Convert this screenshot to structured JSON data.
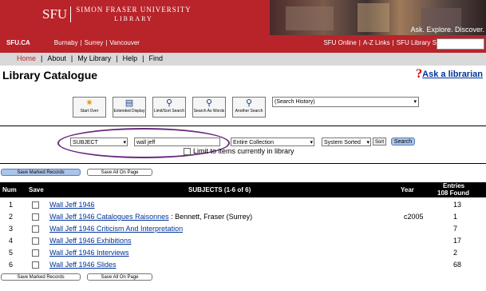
{
  "header": {
    "logo": "SFU",
    "university_name": "SIMON FRASER UNIVERSITY",
    "library_name": "LIBRARY",
    "tagline": "Ask. Explore. Discover.",
    "nav_left": [
      "SFU.CA",
      "Burnaby",
      "Surrey",
      "Vancouver"
    ],
    "nav_right": [
      "SFU Online",
      "A-Z Links",
      "SFU Library Search"
    ]
  },
  "subnav": [
    "Home",
    "About",
    "My Library",
    "Help",
    "Find"
  ],
  "page": {
    "title": "Library Catalogue",
    "ask_label": "Ask a librarian"
  },
  "toolbar": {
    "buttons": [
      "Start Over",
      "Extended Display",
      "Limit/Sort Search",
      "Search As Words",
      "Another Search"
    ],
    "history_placeholder": "(Search History)"
  },
  "search": {
    "field": "SUBJECT",
    "query": "wall jeff",
    "scope": "Entire Collection",
    "sort": "System Sorted",
    "sort_button": "Sort",
    "search_button": "Search",
    "limit_label": "Limit to items currently in library"
  },
  "actions": {
    "save_marked": "Save Marked Records",
    "save_all": "Save All On Page"
  },
  "table": {
    "columns": {
      "num": "Num",
      "save": "Save",
      "subjects": "SUBJECTS (1-6 of 6)",
      "year": "Year",
      "entries_line1": "Entries",
      "entries_line2": "108 Found"
    },
    "rows": [
      {
        "num": "1",
        "link": "Wall Jeff 1946",
        "extra": "",
        "year": "",
        "entries": "13"
      },
      {
        "num": "2",
        "link": "Wall Jeff 1946 Catalogues Raisonnes",
        "extra": " : Bennett, Fraser (Surrey)",
        "year": "c2005",
        "entries": "1"
      },
      {
        "num": "3",
        "link": "Wall Jeff 1946 Criticism And Interpretation",
        "extra": "",
        "year": "",
        "entries": "7"
      },
      {
        "num": "4",
        "link": "Wall Jeff 1946 Exhibitions",
        "extra": "",
        "year": "",
        "entries": "17"
      },
      {
        "num": "5",
        "link": "Wall Jeff 1946 Interviews",
        "extra": "",
        "year": "",
        "entries": "2"
      },
      {
        "num": "6",
        "link": "Wall Jeff 1946 Slides",
        "extra": "",
        "year": "",
        "entries": "68"
      }
    ]
  }
}
